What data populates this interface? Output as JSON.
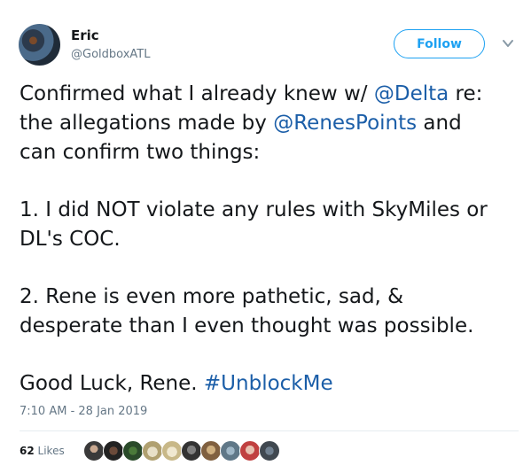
{
  "author": {
    "name": "Eric",
    "handle": "@GoldboxATL"
  },
  "follow_label": "Follow",
  "tweet": {
    "line1_pre": "Confirmed what I already knew w/ ",
    "mention1": "@Delta",
    "line1_post": " re:",
    "line2_pre": "the allegations made by ",
    "mention2": "@RenesPoints",
    "line2_post": " and",
    "line3": "can confirm two things:",
    "line4": "1. I did NOT violate any rules with SkyMiles or",
    "line5": "DL's COC.",
    "line6": "2. Rene is even more pathetic, sad, &",
    "line7": "desperate than I even thought was possible.",
    "line8_pre": "Good Luck, Rene.  ",
    "hashtag": "#UnblockMe"
  },
  "timestamp": "7:10 AM - 28 Jan 2019",
  "likes": {
    "count": "62",
    "label": "Likes"
  },
  "colors": {
    "link": "#1b5ea8",
    "follow": "#1da1f2",
    "muted": "#657786"
  }
}
